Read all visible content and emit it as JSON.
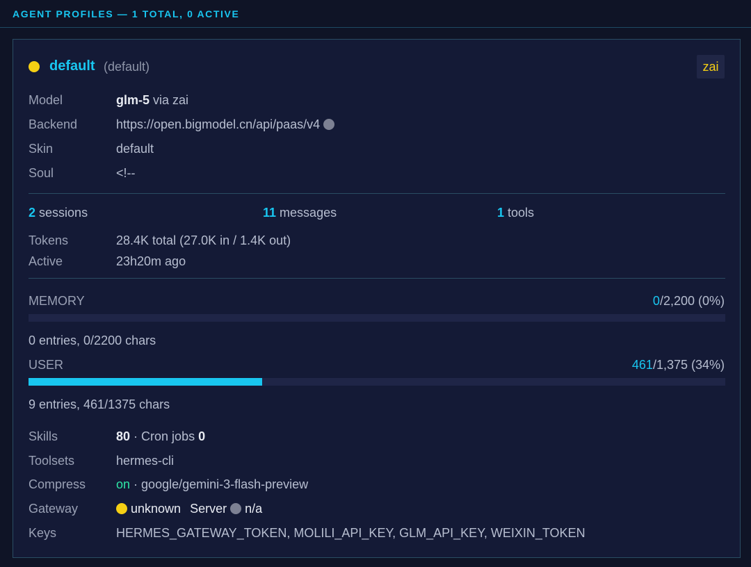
{
  "header": {
    "title": "AGENT PROFILES — 1 TOTAL, 0 ACTIVE"
  },
  "profile": {
    "name": "default",
    "tag": "(default)",
    "badge": "zai",
    "status_color": "#f5cf14",
    "labels": {
      "model": "Model",
      "backend": "Backend",
      "skin": "Skin",
      "soul": "Soul",
      "tokens": "Tokens",
      "active": "Active",
      "skills": "Skills",
      "toolsets": "Toolsets",
      "compress": "Compress",
      "gateway": "Gateway",
      "keys": "Keys"
    },
    "model": {
      "name": "glm-5",
      "via": "via zai"
    },
    "backend": {
      "url": "https://open.bigmodel.cn/api/paas/v4"
    },
    "skin": "default",
    "soul": "<!--",
    "stats": {
      "sessions_count": "2",
      "sessions_label": "sessions",
      "messages_count": "11",
      "messages_label": "messages",
      "tools_count": "1",
      "tools_label": "tools"
    },
    "tokens": "28.4K total (27.0K in / 1.4K out)",
    "active": "23h20m ago",
    "memory": {
      "title": "MEMORY",
      "used": "0",
      "total_text": "/2,200 (0%)",
      "fraction": 0.0,
      "entries": "0 entries, 0/2200 chars"
    },
    "user": {
      "title": "USER",
      "used": "461",
      "total_text": "/1,375 (34%)",
      "fraction": 0.3353,
      "entries": "9 entries, 461/1375 chars"
    },
    "skills": {
      "count": "80",
      "cron_label": "· Cron jobs",
      "cron_count": "0"
    },
    "toolsets": "hermes-cli",
    "compress": {
      "state": "on",
      "model": "· google/gemini-3-flash-preview"
    },
    "gateway": {
      "status": "unknown",
      "server_label": "Server",
      "server_status": "n/a"
    },
    "keys": "HERMES_GATEWAY_TOKEN, MOLILI_API_KEY, GLM_API_KEY, WEIXIN_TOKEN"
  }
}
